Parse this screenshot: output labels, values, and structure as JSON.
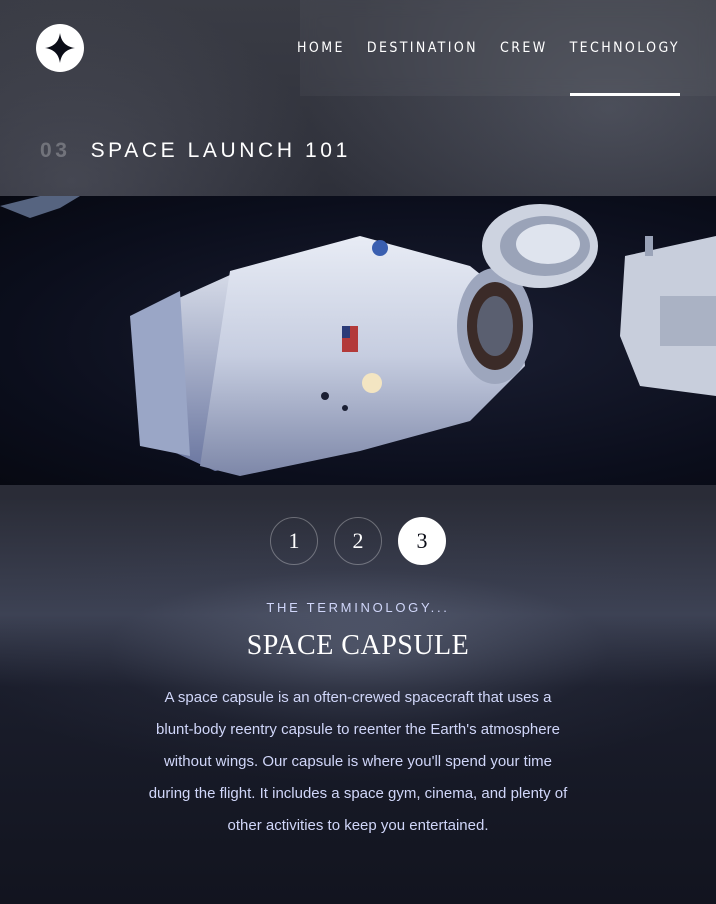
{
  "brand": {
    "logo_icon": "star-icon",
    "logo_color": "#ffffff"
  },
  "nav": {
    "items": [
      {
        "label": "HOME",
        "active": false
      },
      {
        "label": "DESTINATION",
        "active": false
      },
      {
        "label": "CREW",
        "active": false
      },
      {
        "label": "TECHNOLOGY",
        "active": true
      }
    ]
  },
  "page": {
    "number": "03",
    "title": "SPACE LAUNCH 101"
  },
  "steps": [
    "1",
    "2",
    "3"
  ],
  "active_step": "3",
  "tech": {
    "eyebrow": "THE TERMINOLOGY...",
    "name": "SPACE CAPSULE",
    "description": "A space capsule is an often-crewed spacecraft that uses a blunt-body reentry capsule to reenter the Earth's atmosphere without wings. Our capsule is where you'll spend your time during the flight. It includes a space gym, cinema, and plenty of other activities to keep you entertained."
  },
  "colors": {
    "background": "#0b0d17",
    "accent": "#d0d6f9",
    "text": "#ffffff"
  }
}
